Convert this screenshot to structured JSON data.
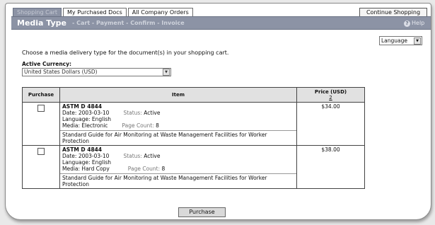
{
  "tabs": [
    {
      "label": "Shopping Cart",
      "active": true
    },
    {
      "label": "My Purchased Docs",
      "active": false
    },
    {
      "label": "All Company Orders",
      "active": false
    }
  ],
  "continue_label": "Continue Shopping",
  "header": {
    "title": "Media Type",
    "steps": "- Cart - Payment - Confirm - Invoice",
    "help": "Help"
  },
  "language_select": "Language",
  "intro": "Choose a media delivery type for the document(s) in your shopping cart.",
  "currency": {
    "label": "Active Currency:",
    "value": "United States Dollars (USD)"
  },
  "table": {
    "headers": {
      "purchase": "Purchase",
      "item": "Item",
      "price": "Price (USD)",
      "price_sort": "2"
    },
    "rows": [
      {
        "name": "ASTM D 4844",
        "date": "Date: 2003-03-10",
        "status_label": "Status:",
        "status": "Active",
        "language": "Language: English",
        "media": "Media: Electronic",
        "page_label": "Page Count:",
        "page_count": "8",
        "description": "Standard Guide for Air Monitoring at Waste Management Facilities for Worker Protection",
        "price": "$34.00"
      },
      {
        "name": "ASTM D 4844",
        "date": "Date: 2003-03-10",
        "status_label": "Status:",
        "status": "Active",
        "language": "Language: English",
        "media": "Media: Hard Copy",
        "page_label": "Page Count:",
        "page_count": "8",
        "description": "Standard Guide for Air Monitoring at Waste Management Facilities for Worker Protection",
        "price": "$38.00"
      }
    ]
  },
  "purchase_button": "Purchase",
  "colors": {
    "accent": "#8c93a5",
    "accent_dark": "#6b7385"
  }
}
